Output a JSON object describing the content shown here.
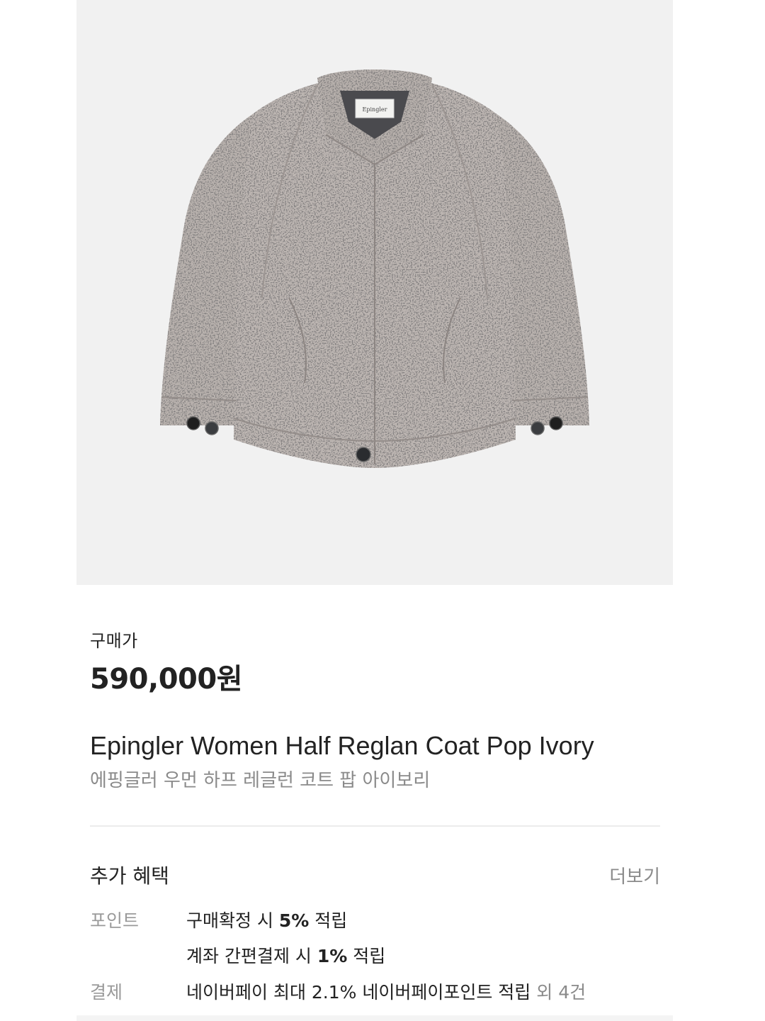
{
  "product": {
    "image_alt": "Epingler Women Half Reglan Coat Pop Ivory",
    "label_text": "Epingler",
    "price_label": "구매가",
    "price": "590,000원",
    "name_en": "Epingler Women Half Reglan Coat Pop Ivory",
    "name_ko": "에핑글러 우먼 하프 레글런 코트 팝 아이보리"
  },
  "benefits": {
    "title": "추가 혜택",
    "more": "더보기",
    "point_label": "포인트",
    "point_line1_pre": "구매확정 시 ",
    "point_line1_bold": "5%",
    "point_line1_post": " 적립",
    "point_line2_pre": "계좌 간편결제 시 ",
    "point_line2_bold": "1%",
    "point_line2_post": " 적립",
    "payment_label": "결제",
    "payment_text": "네이버페이 최대 2.1% 네이버페이포인트 적립",
    "payment_extra": " 외 4건"
  },
  "colors": {
    "image_bg": "#f1f1f1",
    "coat": "#b9b2ae",
    "text_primary": "#222222",
    "text_secondary": "#8a8a8a"
  }
}
